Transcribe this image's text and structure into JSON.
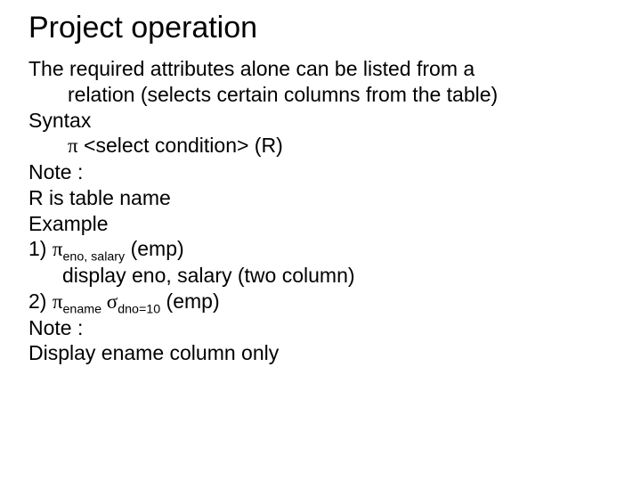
{
  "title": "Project operation",
  "line1": "The required attributes alone can be listed from a",
  "line1b": "relation (selects certain columns from the table)",
  "syntax_label": "Syntax",
  "syntax_pi": "π",
  "syntax_rest": " <select condition> (R)",
  "note_label": "Note :",
  "note_line": "R is table name",
  "example_label": "Example",
  "ex1_num": "1)  ",
  "ex1_pi": "π",
  "ex1_sub": "eno, salary",
  "ex1_rest": " (emp)",
  "ex1_desc": "display eno, salary (two column)",
  "ex2_num": "2) ",
  "ex2_pi": "π",
  "ex2_sub1": "ename",
  "ex2_sigma": " σ",
  "ex2_sub2": "dno=10",
  "ex2_rest": " (emp)",
  "note2_label": "Note :",
  "note2_line": "Display ename column only"
}
